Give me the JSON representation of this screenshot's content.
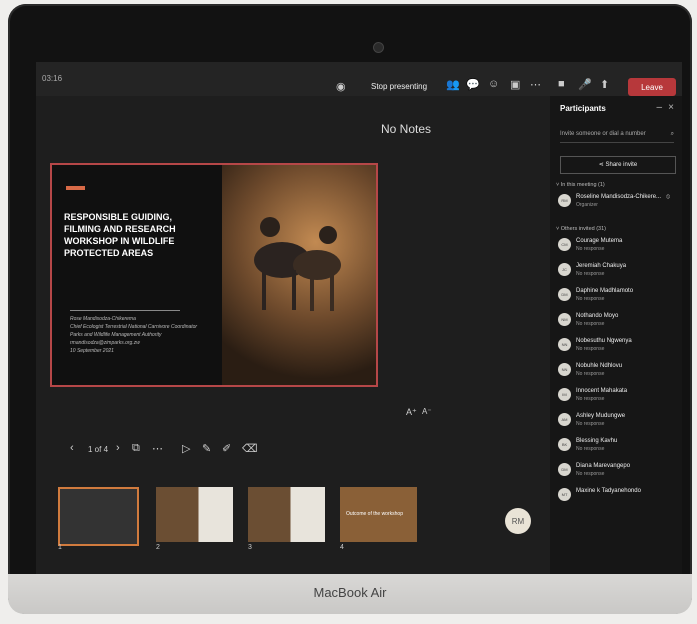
{
  "topbar": {
    "clock": "03:16",
    "stop_presenting": "Stop presenting",
    "leave": "Leave"
  },
  "notes": {
    "label": "No Notes"
  },
  "slide": {
    "title_lines": [
      "RESPONSIBLE GUIDING,",
      "FILMING AND RESEARCH",
      "WORKSHOP IN WILDLIFE",
      "PROTECTED AREAS"
    ],
    "meta_lines": [
      "Rose Mandisodza-Chikerema",
      "Chief Ecologist Terrestrial National Carnivore Coordinator",
      "Parks and Wildlife Management Authority",
      "rmandisodza@zimparks.org.zw",
      "10 September 2021"
    ]
  },
  "controls": {
    "page": "1 of 4",
    "font_inc": "A",
    "font_dec": "A"
  },
  "thumbnails": [
    {
      "num": "1"
    },
    {
      "num": "2"
    },
    {
      "num": "3"
    },
    {
      "num": "4",
      "caption": "Outcome of the workshop"
    }
  ],
  "presenter_avatar": "RM",
  "participants": {
    "title": "Participants",
    "invite_placeholder": "Invite someone or dial a number",
    "share_invite": "Share invite",
    "in_meeting_label": "In this meeting (1)",
    "others_label": "Others invited (31)",
    "in_meeting": [
      {
        "initials": "RM",
        "name": "Roseline Mandisodza-Chikere...",
        "status": "Organizer"
      }
    ],
    "others": [
      {
        "initials": "CM",
        "name": "Courage Mutema",
        "status": "No response"
      },
      {
        "initials": "JC",
        "name": "Jeremiah Chakuya",
        "status": "No response"
      },
      {
        "initials": "DM",
        "name": "Daphine Madhlamoto",
        "status": "No response"
      },
      {
        "initials": "NM",
        "name": "Nothando Moyo",
        "status": "No response"
      },
      {
        "initials": "NN",
        "name": "Nobesuthu Ngwenya",
        "status": "No response"
      },
      {
        "initials": "NN",
        "name": "Nobuhle Ndhlovu",
        "status": "No response"
      },
      {
        "initials": "IM",
        "name": "Innocent Mahakata",
        "status": "No response"
      },
      {
        "initials": "AM",
        "name": "Ashley Mudungwe",
        "status": "No response"
      },
      {
        "initials": "BK",
        "name": "Blessing Kavhu",
        "status": "No response"
      },
      {
        "initials": "DM",
        "name": "Diana Marevangepo",
        "status": "No response"
      },
      {
        "initials": "MT",
        "name": "Maxine k Tadyanehondo",
        "status": ""
      }
    ]
  },
  "device": {
    "brand": "MacBook Air"
  },
  "colors": {
    "leave": "#b7383b",
    "slide_border": "#b64748",
    "accent": "#d86a47"
  }
}
